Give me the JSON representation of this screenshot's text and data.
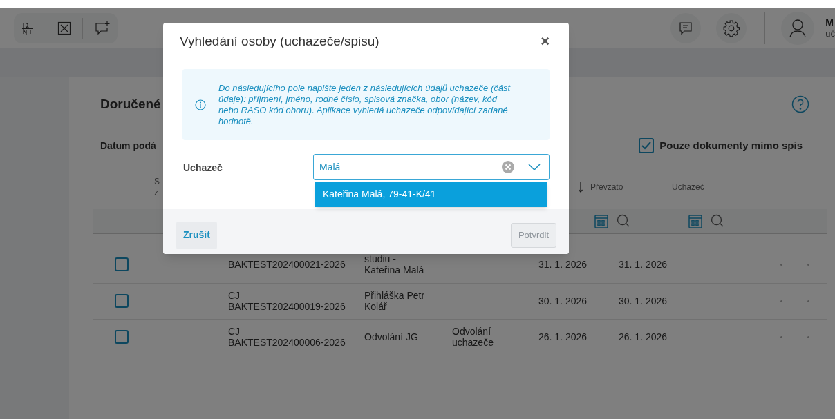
{
  "header": {
    "user_name": "M",
    "user_role": "uč"
  },
  "page": {
    "title": "Doručené",
    "filter_label": "Datum podá",
    "only_outside_file": {
      "label": "Pouze dokumenty mimo spis",
      "checked": true
    }
  },
  "table": {
    "columns": [
      {
        "label": "S z",
        "kind": "text"
      },
      {
        "kind": "sort"
      },
      {
        "label": "Převzato",
        "kind": "text"
      },
      {
        "label": "Uchazeč",
        "kind": "text"
      }
    ],
    "rows": [
      {
        "checked": false,
        "file": "BAKTEST202400021-2026",
        "name": "studiu -\nKateřina Malá",
        "submitted": "31. 1. 2026",
        "received": "31. 1. 2026"
      },
      {
        "checked": false,
        "file": "CJ\nBAKTEST202400019-2026",
        "name": "Přihláška Petr\nKolář",
        "submitted": "30. 1. 2026",
        "received": "30. 1. 2026"
      },
      {
        "checked": false,
        "file": "CJ\nBAKTEST202400006-2026",
        "name": "Odvolání JG",
        "type": "Odvolání uchazeče",
        "submitted": "26. 1. 2026",
        "received": "26. 1. 2026"
      }
    ]
  },
  "dialog": {
    "title": "Vyhledání osoby (uchazeče/spisu)",
    "close": "×",
    "info": "Do následujícího pole napište jeden z následujících údajů uchazeče (část údaje): příjmení, jméno, rodné číslo, spisová značka, obor (název, kód nebo RASO kód oboru). Aplikace vyhledá uchazeče odpovídající zadané hodnotě.",
    "field_label": "Uchazeč",
    "value": "Malá",
    "options": [
      {
        "label": "Kateřina Malá, 79-41-K/41",
        "selected": true
      }
    ],
    "cancel": "Zrušit",
    "confirm": {
      "label": "Potvrdit",
      "disabled": true
    }
  }
}
